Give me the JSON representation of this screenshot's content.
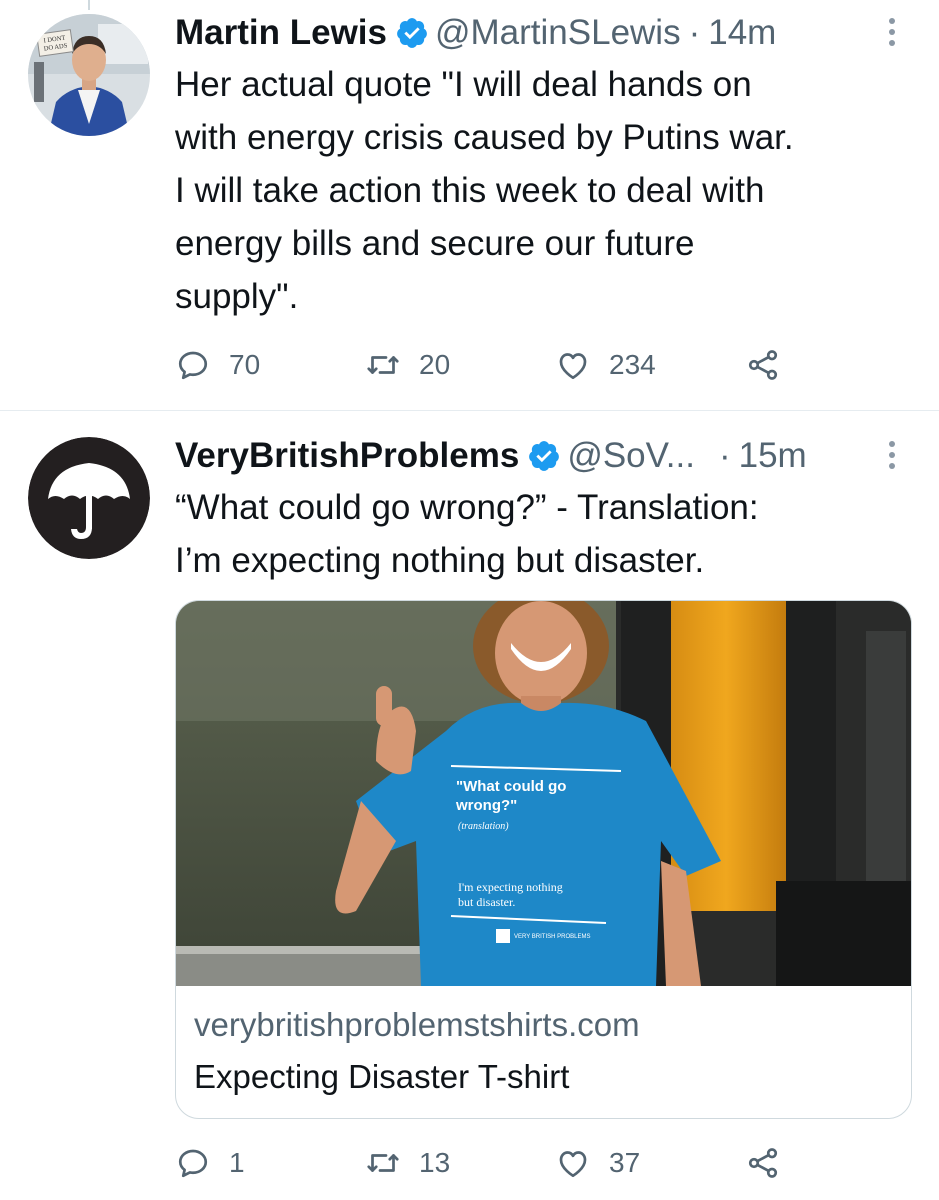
{
  "tweets": [
    {
      "name": "Martin Lewis",
      "handle": "@MartinSLewis",
      "time": "14m",
      "avatar_sign_text": "I DONT DO ADS",
      "text_lines": [
        "Her actual quote \"I will deal hands on",
        "with energy crisis caused by Putins war.",
        "I will take action this week to deal with",
        "energy bills and secure our future",
        "supply\"."
      ],
      "replies": "70",
      "retweets": "20",
      "likes": "234"
    },
    {
      "name": "VeryBritishProblems",
      "handle": "@SoV...",
      "time": "15m",
      "text_lines": [
        "“What could go wrong?” - Translation:",
        "I’m expecting nothing but disaster."
      ],
      "card": {
        "shirt_text_1": "\"What could go",
        "shirt_text_2": "wrong?\"",
        "shirt_text_3": "(translation)",
        "shirt_text_4": "I'm expecting nothing",
        "shirt_text_5": "but disaster.",
        "shirt_logo_text": "VERY BRITISH PROBLEMS",
        "domain": "verybritishproblemstshirts.com",
        "title": "Expecting Disaster T-shirt"
      },
      "replies": "1",
      "retweets": "13",
      "likes": "37"
    }
  ],
  "icons": {
    "verified": "verified-badge-icon",
    "reply": "reply-icon",
    "retweet": "retweet-icon",
    "like": "heart-icon",
    "share": "share-icon",
    "more": "more-icon"
  },
  "colors": {
    "verified_blue": "#1d9bf0",
    "secondary_text": "#536471",
    "primary_text": "#0f1419",
    "shirt_blue": "#1e88c8"
  }
}
